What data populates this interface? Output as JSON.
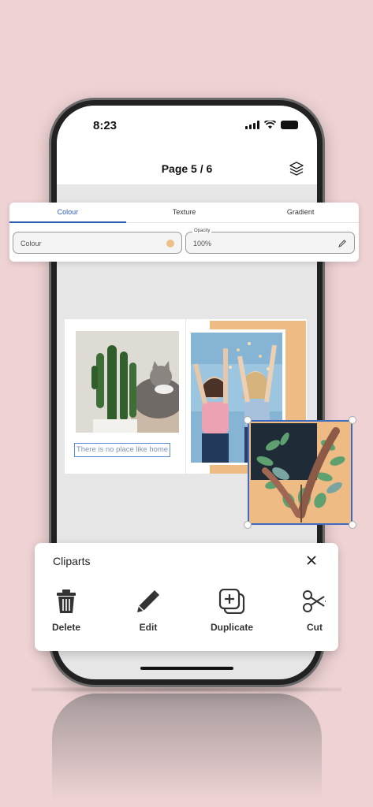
{
  "status_bar": {
    "time": "8:23"
  },
  "header": {
    "page_label": "Page 5 / 6"
  },
  "color_panel": {
    "tabs": [
      {
        "label": "Colour",
        "active": true
      },
      {
        "label": "Texture",
        "active": false
      },
      {
        "label": "Gradient",
        "active": false
      }
    ],
    "colour_field": {
      "value": "Colour",
      "swatch": "#eec089"
    },
    "opacity_field": {
      "legend": "Opacity",
      "value": "100%"
    }
  },
  "canvas": {
    "caption_text": "There is no place like home",
    "accent_color": "#efbb85",
    "selection_color": "#3e6bc0"
  },
  "sheet": {
    "title": "Cliparts",
    "actions": [
      {
        "label": "Delete",
        "icon": "trash-icon"
      },
      {
        "label": "Edit",
        "icon": "pencil-icon"
      },
      {
        "label": "Duplicate",
        "icon": "duplicate-icon"
      },
      {
        "label": "Cut",
        "icon": "scissors-icon"
      }
    ]
  },
  "colors": {
    "background": "#efd3d4",
    "tab_active": "#2b5bb5"
  }
}
